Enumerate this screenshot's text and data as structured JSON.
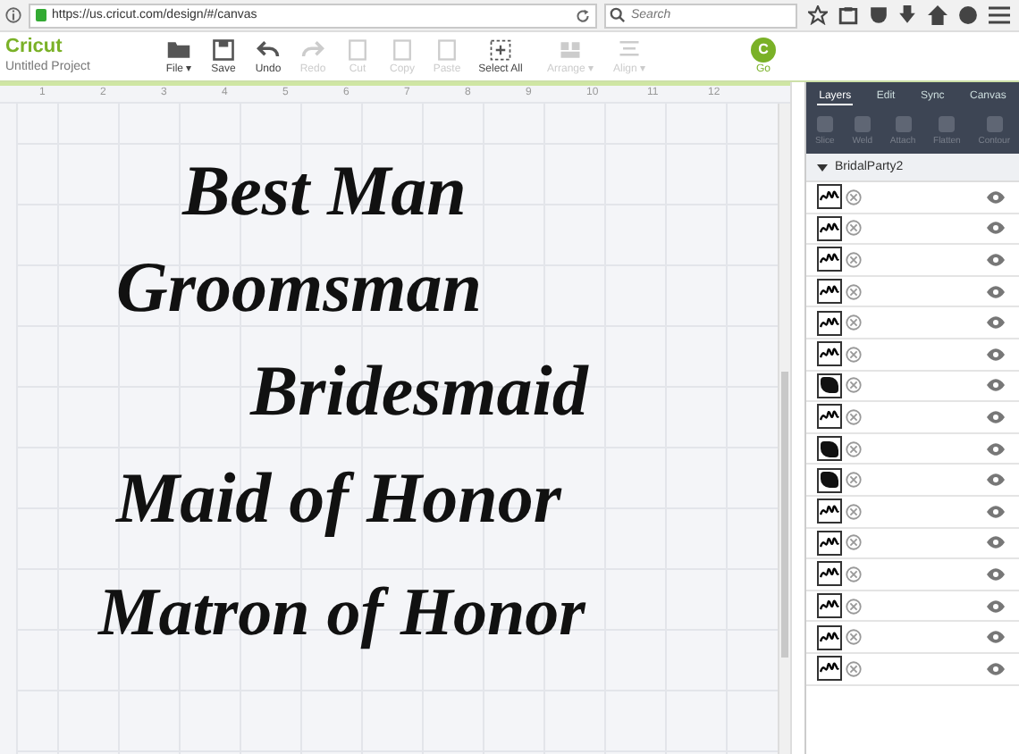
{
  "browser": {
    "url": "https://us.cricut.com/design/#/canvas",
    "search": {
      "placeholder": "Search"
    }
  },
  "app": {
    "logo": "Cricut",
    "project": "Untitled Project"
  },
  "toolbar": [
    {
      "label": "File ▾",
      "kind": "folder",
      "disabled": false
    },
    {
      "label": "Save",
      "kind": "save",
      "disabled": false
    },
    {
      "label": "Undo",
      "kind": "undo",
      "disabled": false
    },
    {
      "label": "Redo",
      "kind": "redo",
      "disabled": true
    },
    {
      "label": "Cut",
      "kind": "box",
      "disabled": true
    },
    {
      "label": "Copy",
      "kind": "box",
      "disabled": true
    },
    {
      "label": "Paste",
      "kind": "box",
      "disabled": true
    },
    {
      "label": "Select All",
      "kind": "select",
      "disabled": false
    },
    {
      "label": "Arrange ▾",
      "kind": "grid",
      "disabled": true
    },
    {
      "label": "Align ▾",
      "kind": "lines",
      "disabled": true
    }
  ],
  "go": {
    "icon": "C",
    "label": "Go"
  },
  "ruler": [
    "1",
    "2",
    "3",
    "4",
    "5",
    "6",
    "7",
    "8",
    "9",
    "10",
    "11",
    "12"
  ],
  "canvas_texts": [
    "Best Man",
    "Groomsman",
    "Bridesmaid",
    "Maid of Honor",
    "Matron of Honor"
  ],
  "panel": {
    "tabs": [
      {
        "label": "Layers",
        "selected": true
      },
      {
        "label": "Edit",
        "selected": false
      },
      {
        "label": "Sync",
        "selected": false
      },
      {
        "label": "Canvas",
        "selected": false
      }
    ],
    "actions": [
      {
        "label": "Slice",
        "disabled": true
      },
      {
        "label": "Weld",
        "disabled": true
      },
      {
        "label": "Attach",
        "disabled": true
      },
      {
        "label": "Flatten",
        "disabled": true
      },
      {
        "label": "Contour",
        "disabled": true
      }
    ],
    "group": {
      "name": "BridalParty2",
      "expanded": true
    },
    "layers": [
      {
        "kind": "script",
        "visible": true
      },
      {
        "kind": "script",
        "visible": true
      },
      {
        "kind": "script",
        "visible": true
      },
      {
        "kind": "script",
        "visible": true
      },
      {
        "kind": "script",
        "visible": true
      },
      {
        "kind": "script",
        "visible": true
      },
      {
        "kind": "shape",
        "visible": true
      },
      {
        "kind": "script",
        "visible": true
      },
      {
        "kind": "shape",
        "visible": true
      },
      {
        "kind": "shape",
        "visible": true
      },
      {
        "kind": "script",
        "visible": true
      },
      {
        "kind": "script",
        "visible": true
      },
      {
        "kind": "script",
        "visible": true
      },
      {
        "kind": "script",
        "visible": true
      },
      {
        "kind": "script",
        "visible": true
      },
      {
        "kind": "script",
        "visible": true
      }
    ]
  }
}
